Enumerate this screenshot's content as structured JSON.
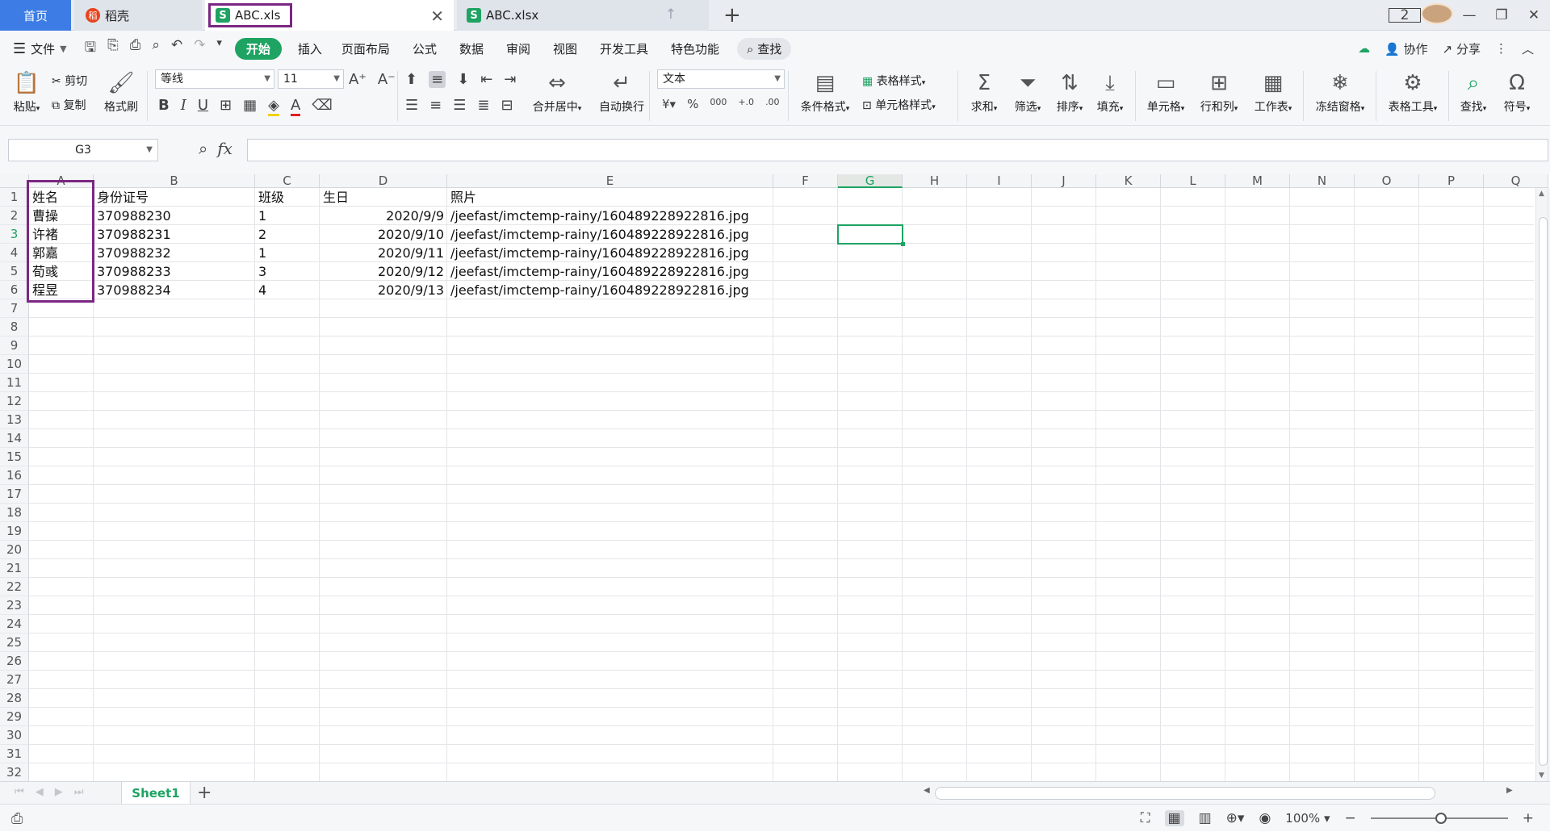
{
  "tabs": {
    "home": "首页",
    "daoke": "稻壳",
    "active_file": "ABC.xls",
    "other_file": "ABC.xlsx",
    "new_tab": "+",
    "window_badge": "2"
  },
  "menu": {
    "file": "文件",
    "start": "开始",
    "items": [
      "插入",
      "页面布局",
      "公式",
      "数据",
      "审阅",
      "视图",
      "开发工具",
      "特色功能"
    ],
    "search": "查找",
    "collab": "协作",
    "share": "分享"
  },
  "ribbon": {
    "paste": "粘贴",
    "cut": "剪切",
    "copy": "复制",
    "format_painter": "格式刷",
    "font_name": "等线",
    "font_size": "11",
    "merge_center": "合并居中",
    "wrap_text": "自动换行",
    "number_format": "文本",
    "cond_format": "条件格式",
    "table_style": "表格样式",
    "cell_style": "单元格样式",
    "sum": "求和",
    "filter": "筛选",
    "sort": "排序",
    "fill": "填充",
    "cell": "单元格",
    "row_col": "行和列",
    "worksheet": "工作表",
    "freeze": "冻结窗格",
    "table_tools": "表格工具",
    "find": "查找",
    "symbol": "符号"
  },
  "formula_bar": {
    "name_box": "G3",
    "fx": "fx",
    "value": ""
  },
  "grid": {
    "columns": [
      "A",
      "B",
      "C",
      "D",
      "E",
      "F",
      "G",
      "H",
      "I",
      "J",
      "K",
      "L",
      "M",
      "N",
      "O",
      "P",
      "Q"
    ],
    "row_numbers": [
      "1",
      "2",
      "3",
      "4",
      "5",
      "6",
      "7",
      "8",
      "9",
      "10",
      "11",
      "12",
      "13",
      "14",
      "15",
      "16",
      "17",
      "18",
      "19",
      "20",
      "21",
      "22",
      "23",
      "24",
      "25",
      "26",
      "27",
      "28",
      "29",
      "30",
      "31",
      "32"
    ],
    "header": [
      "姓名",
      "身份证号",
      "班级",
      "生日",
      "照片"
    ],
    "rows": [
      [
        "曹操",
        "370988230",
        "1",
        "2020/9/9",
        "/jeefast/imctemp-rainy/160489228922816.jpg"
      ],
      [
        "许褚",
        "370988231",
        "2",
        "2020/9/10",
        "/jeefast/imctemp-rainy/160489228922816.jpg"
      ],
      [
        "郭嘉",
        "370988232",
        "1",
        "2020/9/11",
        "/jeefast/imctemp-rainy/160489228922816.jpg"
      ],
      [
        "荀彧",
        "370988233",
        "3",
        "2020/9/12",
        "/jeefast/imctemp-rainy/160489228922816.jpg"
      ],
      [
        "程昱",
        "370988234",
        "4",
        "2020/9/13",
        "/jeefast/imctemp-rainy/160489228922816.jpg"
      ]
    ],
    "selected_cell": "G3"
  },
  "sheet_tabs": [
    "Sheet1"
  ],
  "status": {
    "zoom": "100%"
  },
  "colors": {
    "accent_green": "#1ea362",
    "annotation_purple": "#7b2782",
    "home_tab_blue": "#3c7ce4"
  }
}
